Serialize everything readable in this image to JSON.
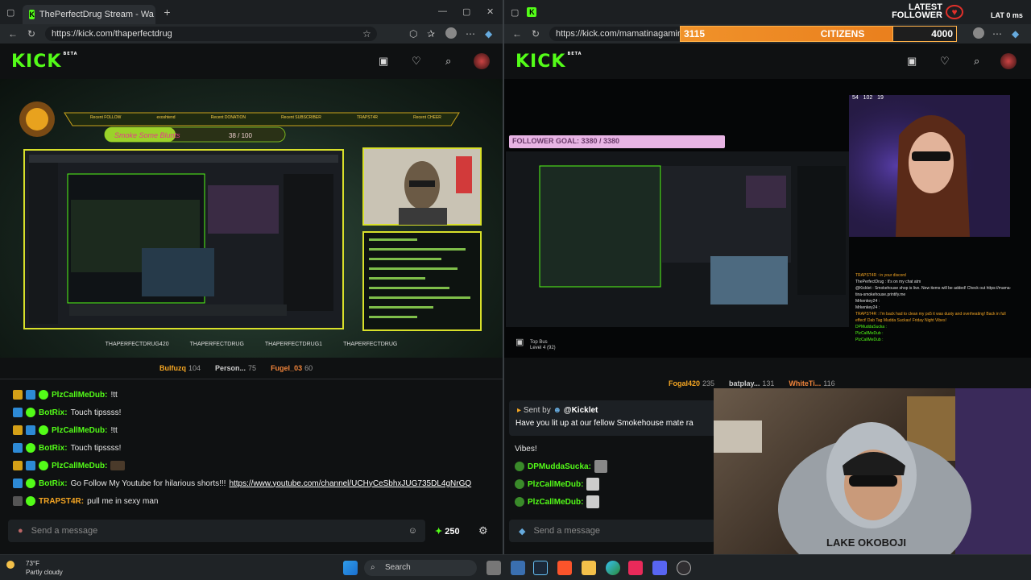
{
  "left_window": {
    "tab_title": "ThePerfectDrug Stream - Wa",
    "url": "https://kick.com/thaperfectdrug",
    "brand": "KICK",
    "brand_sup": "BETA",
    "overlay": {
      "labels": [
        "Recent FOLLOW",
        "Recent DONATION",
        "Recent SUBSCRIBER",
        "Recent CHEER"
      ],
      "values": [
        "exoshtend",
        "",
        "TRAPST4R",
        ""
      ],
      "goal_label": "Smoke Some Blunts",
      "goal_value": "38 / 100"
    },
    "socials": [
      "THAPERFECTDRUG420",
      "THAPERFECTDRUG",
      "THAPERFECTDRUG1",
      "THAPERFECTDRUG"
    ],
    "gifters": [
      {
        "name": "Bulfuzq",
        "count": "104"
      },
      {
        "name": "Person...",
        "count": "75"
      },
      {
        "name": "Fugel_03",
        "count": "60"
      }
    ],
    "chat": [
      {
        "user": "PlzCallMeDub:",
        "text": "!tt",
        "color": "#53fc18",
        "badges": 3
      },
      {
        "user": "BotRix:",
        "text": "Touch tipssss!",
        "color": "#53fc18",
        "badges": 1
      },
      {
        "user": "PlzCallMeDub:",
        "text": "!tt",
        "color": "#53fc18",
        "badges": 3
      },
      {
        "user": "BotRix:",
        "text": "Touch tipssss!",
        "color": "#53fc18",
        "badges": 1
      },
      {
        "user": "PlzCallMeDub:",
        "text": "",
        "color": "#53fc18",
        "badges": 3
      },
      {
        "user": "BotRix:",
        "text": "Go Follow My Youtube for hilarious shorts!!!",
        "link": "https://www.youtube.com/channel/UCHyCeSbhxJUG735DL4gNrGQ",
        "color": "#53fc18",
        "badges": 1
      },
      {
        "user": "TRAPST4R:",
        "text": "pull me in sexy man",
        "color": "#f5a623",
        "badges": 1
      }
    ],
    "send_placeholder": "Send a message",
    "points": "250"
  },
  "right_window": {
    "url": "https://kick.com/mamatinagaming",
    "brand": "KICK",
    "brand_sup": "BETA",
    "citizens_banner": {
      "left": "3115",
      "center": "CITIZENS",
      "right": "4000"
    },
    "latest_follower": "LATEST FOLLOWER",
    "latency": "LAT 0 ms",
    "follower_goal": "FOLLOWER GOAL: 3380 / 3380",
    "cam_stats": "54   102   19",
    "stream_tag": "Top Bus",
    "stream_level": "Level 4 (92)",
    "gifters": [
      {
        "name": "Fogal420",
        "count": "235"
      },
      {
        "name": "batplay...",
        "count": "131"
      },
      {
        "name": "WhiteTi...",
        "count": "116"
      }
    ],
    "pinned": {
      "sent_by": "Sent by",
      "sender": "@Kicklet",
      "text": "Have you lit up at our fellow Smokehouse mate ra"
    },
    "chat": [
      {
        "user": "",
        "text": "Vibes!"
      },
      {
        "user": "DPMuddaSucka:",
        "text": ""
      },
      {
        "user": "PlzCallMeDub:",
        "text": ""
      },
      {
        "user": "PlzCallMeDub:",
        "text": ""
      }
    ],
    "send_placeholder": "Send a message",
    "mini_chat": [
      "TRAPST4R : in your discord",
      "ThePerfectDrug : It's on my chat atm",
      "@Kicklet : Smokehouse shop is live. New items will be added! Check out https://mama-tina-smokehouse.printify.me",
      "Mrkenkey24 :",
      "Mrkenkey24 :",
      "TRAPST4R : I'm back had to clean my ps5 it was dusty and overheating! Back in full effect! Dab Tag Mudda Suckas! Friday Night Vibes!",
      "DPMuddaSucka :",
      "PlzCallMeDub :",
      "PlzCallMeDub :"
    ],
    "hoodie_text": "LAKE OKOBOJI"
  },
  "taskbar": {
    "weather_temp": "73°F",
    "weather_desc": "Partly cloudy",
    "search": "Search"
  },
  "colors": {
    "kick_green": "#53fc18",
    "gifter_gold": "#f5a623",
    "banner_orange": "#f0922a"
  }
}
